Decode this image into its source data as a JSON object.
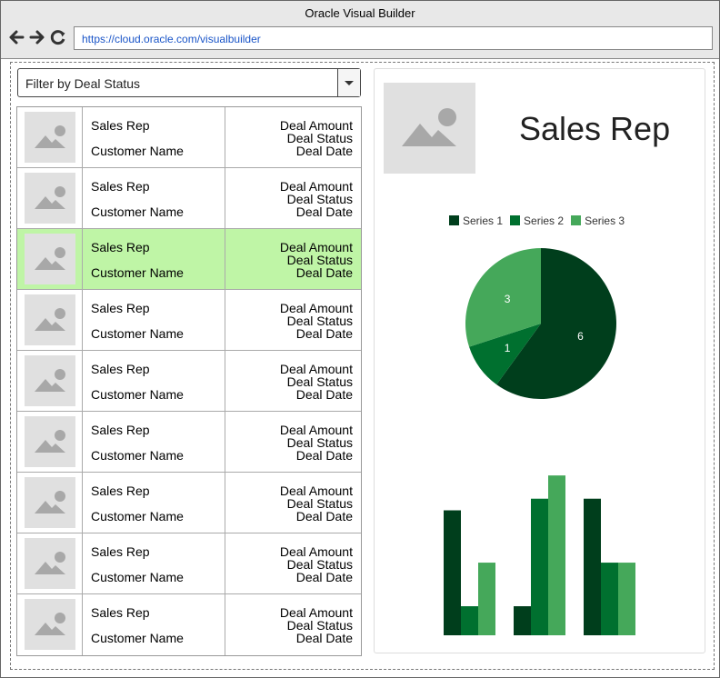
{
  "browser": {
    "title": "Oracle Visual Builder",
    "url": "https://cloud.oracle.com/visualbuilder"
  },
  "filter": {
    "label": "Filter by Deal Status"
  },
  "deals": [
    {
      "rep": "Sales Rep",
      "customer": "Customer Name",
      "amount": "Deal Amount",
      "status": "Deal Status",
      "date": "Deal Date"
    },
    {
      "rep": "Sales Rep",
      "customer": "Customer Name",
      "amount": "Deal Amount",
      "status": "Deal Status",
      "date": "Deal Date"
    },
    {
      "rep": "Sales Rep",
      "customer": "Customer Name",
      "amount": "Deal Amount",
      "status": "Deal Status",
      "date": "Deal Date"
    },
    {
      "rep": "Sales Rep",
      "customer": "Customer Name",
      "amount": "Deal Amount",
      "status": "Deal Status",
      "date": "Deal Date"
    },
    {
      "rep": "Sales Rep",
      "customer": "Customer Name",
      "amount": "Deal Amount",
      "status": "Deal Status",
      "date": "Deal Date"
    },
    {
      "rep": "Sales Rep",
      "customer": "Customer Name",
      "amount": "Deal Amount",
      "status": "Deal Status",
      "date": "Deal Date"
    },
    {
      "rep": "Sales Rep",
      "customer": "Customer Name",
      "amount": "Deal Amount",
      "status": "Deal Status",
      "date": "Deal Date"
    },
    {
      "rep": "Sales Rep",
      "customer": "Customer Name",
      "amount": "Deal Amount",
      "status": "Deal Status",
      "date": "Deal Date"
    },
    {
      "rep": "Sales Rep",
      "customer": "Customer Name",
      "amount": "Deal Amount",
      "status": "Deal Status",
      "date": "Deal Date"
    }
  ],
  "selected_row": 2,
  "detail": {
    "title": "Sales Rep"
  },
  "colors": {
    "selected_row": "#bff5a6",
    "series1": "#003e1c",
    "series2": "#00702f",
    "series3": "#45a85a"
  },
  "chart_data": [
    {
      "type": "pie",
      "series": [
        {
          "name": "Series 1",
          "value": 6
        },
        {
          "name": "Series 2",
          "value": 1
        },
        {
          "name": "Series 3",
          "value": 3
        }
      ],
      "legend": "top"
    },
    {
      "type": "bar",
      "categories": [
        "",
        "",
        ""
      ],
      "series": [
        {
          "name": "Series 1",
          "values": [
            4.3,
            1.0,
            4.7
          ]
        },
        {
          "name": "Series 2",
          "values": [
            1.0,
            4.7,
            2.5
          ]
        },
        {
          "name": "Series 3",
          "values": [
            2.5,
            5.5,
            2.5
          ]
        }
      ],
      "ylim": [
        0,
        6.5
      ]
    }
  ]
}
